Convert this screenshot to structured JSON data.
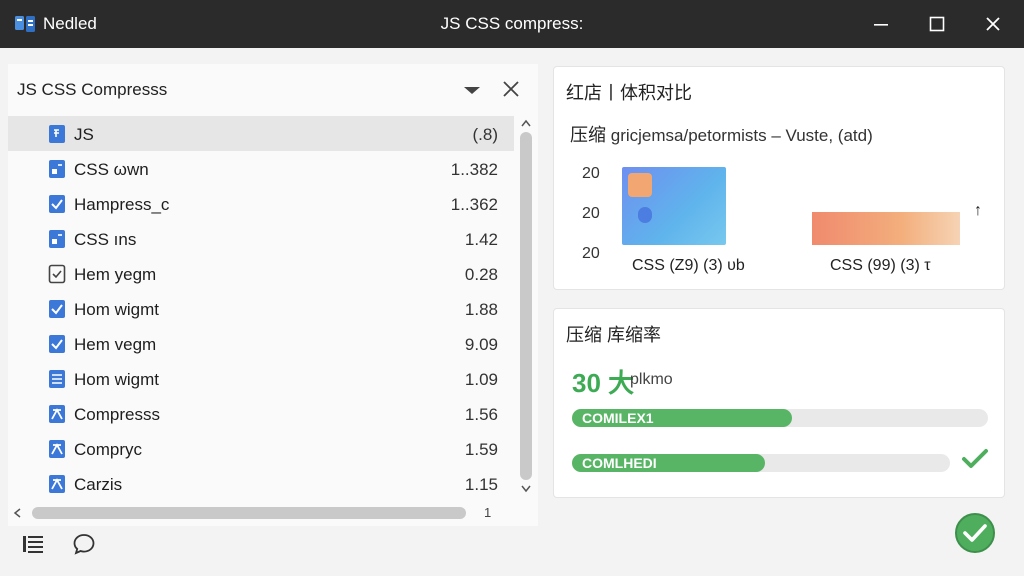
{
  "window": {
    "app_name": "Nedled",
    "title": "JS CSS compress:"
  },
  "left_pane": {
    "title": "JS CSS Compresss",
    "files": [
      {
        "name": "JS",
        "size": "(.8)",
        "icon": "js-file-icon",
        "selected": true
      },
      {
        "name": "CSS ωwn",
        "size": "1..382",
        "icon": "css-file-icon"
      },
      {
        "name": "Hampress_c",
        "size": "1..362",
        "icon": "checked-file-icon"
      },
      {
        "name": "CSS ıns",
        "size": "1.42",
        "icon": "css-file-icon"
      },
      {
        "name": "Hem yegm",
        "size": "0.28",
        "icon": "file-icon"
      },
      {
        "name": "Hom wigmt",
        "size": "1.88",
        "icon": "checked-file-icon"
      },
      {
        "name": "Hem vegm",
        "size": "9.09",
        "icon": "checked-file-icon"
      },
      {
        "name": "Hom wigmt",
        "size": "1.09",
        "icon": "list-file-icon"
      },
      {
        "name": "Compresss",
        "size": "1.56",
        "icon": "compress-file-icon"
      },
      {
        "name": "Compryc",
        "size": "1.59",
        "icon": "compress-file-icon"
      },
      {
        "name": "Carzis",
        "size": "1.15",
        "icon": "compress-file-icon"
      }
    ],
    "hscroll_end": "1"
  },
  "size_card": {
    "title": "红店丨体积对比",
    "subtitle_zh": "压缩",
    "subtitle": "gricjemsa/petormists – Vuste, (atd)",
    "marker": "↑"
  },
  "chart_data": {
    "type": "bar",
    "categories": [
      "CSS (Z9) (3) υb",
      "CSS (99) (3) τ"
    ],
    "yticks": [
      "20",
      "20",
      "20"
    ],
    "colors": [
      "#5fa8ee",
      "#f39a74"
    ]
  },
  "ratio_card": {
    "title": "压缩 库缩率",
    "value": "30 大",
    "unit": "plkmo",
    "bars": [
      {
        "label": "COMILEX1",
        "progress": 0.53
      },
      {
        "label": "COMLHEDI",
        "progress": 0.51
      }
    ]
  },
  "colors": {
    "accent": "#4fae5e",
    "titlebar": "#2b2b2b",
    "icon_blue": "#3c78d8"
  }
}
